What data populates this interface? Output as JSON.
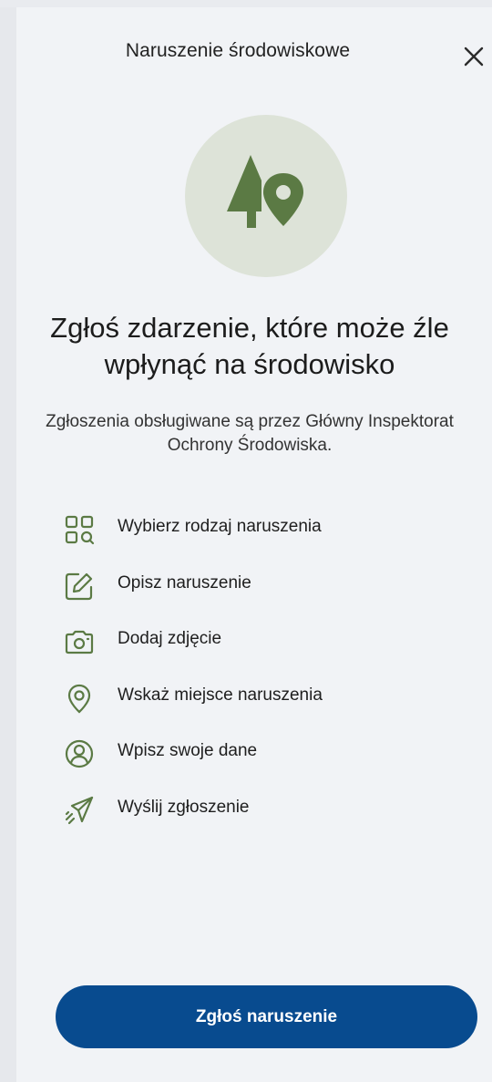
{
  "header": {
    "title": "Naruszenie środowiskowe"
  },
  "hero": {
    "icon": "tree-location-icon"
  },
  "headline": "Zgłoś zdarzenie, które może źle wpłynąć na środowisko",
  "subtext": "Zgłoszenia obsługiwane są przez Główny Inspektorat Ochrony Środowiska.",
  "steps": [
    {
      "label": "Wybierz rodzaj naruszenia",
      "icon": "category-search-icon"
    },
    {
      "label": "Opisz naruszenie",
      "icon": "edit-icon"
    },
    {
      "label": "Dodaj zdjęcie",
      "icon": "camera-icon"
    },
    {
      "label": "Wskaż miejsce naruszenia",
      "icon": "location-pin-icon"
    },
    {
      "label": "Wpisz swoje dane",
      "icon": "user-circle-icon"
    },
    {
      "label": "Wyślij zgłoszenie",
      "icon": "send-icon"
    }
  ],
  "cta": {
    "label": "Zgłoś naruszenie"
  },
  "colors": {
    "accent": "#084b8f",
    "icon_green": "#5b7a44",
    "hero_bg": "#dde3d8",
    "panel_bg": "#f1f3f6"
  }
}
